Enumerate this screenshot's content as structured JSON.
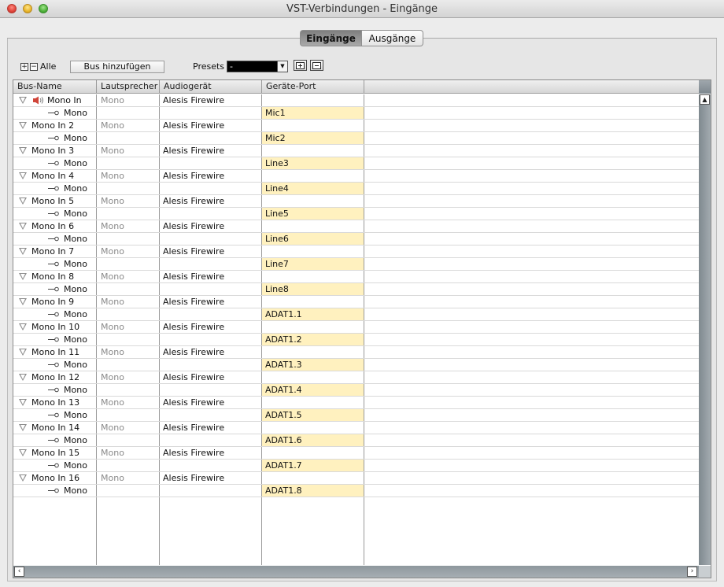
{
  "window": {
    "title": "VST-Verbindungen - Eingänge"
  },
  "tabs": [
    {
      "label": "Eingänge",
      "active": true
    },
    {
      "label": "Ausgänge",
      "active": false
    }
  ],
  "toolbar": {
    "expand_all_glyph": "+",
    "collapse_all_glyph": "−",
    "all_label": "Alle",
    "add_bus_label": "Bus hinzufügen",
    "presets_label": "Presets",
    "preset_value": "-",
    "dropdown_icon": "chevron-down-icon"
  },
  "columns": [
    "Bus-Name",
    "Lautsprecher",
    "Audiogerät",
    "Geräte-Port"
  ],
  "buses": [
    {
      "name": "Mono In",
      "speaker": "Mono",
      "device": "Alesis Firewire",
      "channel": "Mono",
      "port": "Mic1",
      "monitor": true
    },
    {
      "name": "Mono In 2",
      "speaker": "Mono",
      "device": "Alesis Firewire",
      "channel": "Mono",
      "port": "Mic2"
    },
    {
      "name": "Mono In 3",
      "speaker": "Mono",
      "device": "Alesis Firewire",
      "channel": "Mono",
      "port": "Line3"
    },
    {
      "name": "Mono In 4",
      "speaker": "Mono",
      "device": "Alesis Firewire",
      "channel": "Mono",
      "port": "Line4"
    },
    {
      "name": "Mono In 5",
      "speaker": "Mono",
      "device": "Alesis Firewire",
      "channel": "Mono",
      "port": "Line5"
    },
    {
      "name": "Mono In 6",
      "speaker": "Mono",
      "device": "Alesis Firewire",
      "channel": "Mono",
      "port": "Line6"
    },
    {
      "name": "Mono In 7",
      "speaker": "Mono",
      "device": "Alesis Firewire",
      "channel": "Mono",
      "port": "Line7"
    },
    {
      "name": "Mono In 8",
      "speaker": "Mono",
      "device": "Alesis Firewire",
      "channel": "Mono",
      "port": "Line8"
    },
    {
      "name": "Mono In 9",
      "speaker": "Mono",
      "device": "Alesis Firewire",
      "channel": "Mono",
      "port": "ADAT1.1"
    },
    {
      "name": "Mono In 10",
      "speaker": "Mono",
      "device": "Alesis Firewire",
      "channel": "Mono",
      "port": "ADAT1.2"
    },
    {
      "name": "Mono In 11",
      "speaker": "Mono",
      "device": "Alesis Firewire",
      "channel": "Mono",
      "port": "ADAT1.3"
    },
    {
      "name": "Mono In 12",
      "speaker": "Mono",
      "device": "Alesis Firewire",
      "channel": "Mono",
      "port": "ADAT1.4"
    },
    {
      "name": "Mono In 13",
      "speaker": "Mono",
      "device": "Alesis Firewire",
      "channel": "Mono",
      "port": "ADAT1.5"
    },
    {
      "name": "Mono In 14",
      "speaker": "Mono",
      "device": "Alesis Firewire",
      "channel": "Mono",
      "port": "ADAT1.6"
    },
    {
      "name": "Mono In 15",
      "speaker": "Mono",
      "device": "Alesis Firewire",
      "channel": "Mono",
      "port": "ADAT1.7"
    },
    {
      "name": "Mono In 16",
      "speaker": "Mono",
      "device": "Alesis Firewire",
      "channel": "Mono",
      "port": "ADAT1.8"
    }
  ],
  "colors": {
    "port_highlight": "#fff1bf",
    "speaker_icon": "#d0453a",
    "active_tab": "#8c8c8c"
  }
}
